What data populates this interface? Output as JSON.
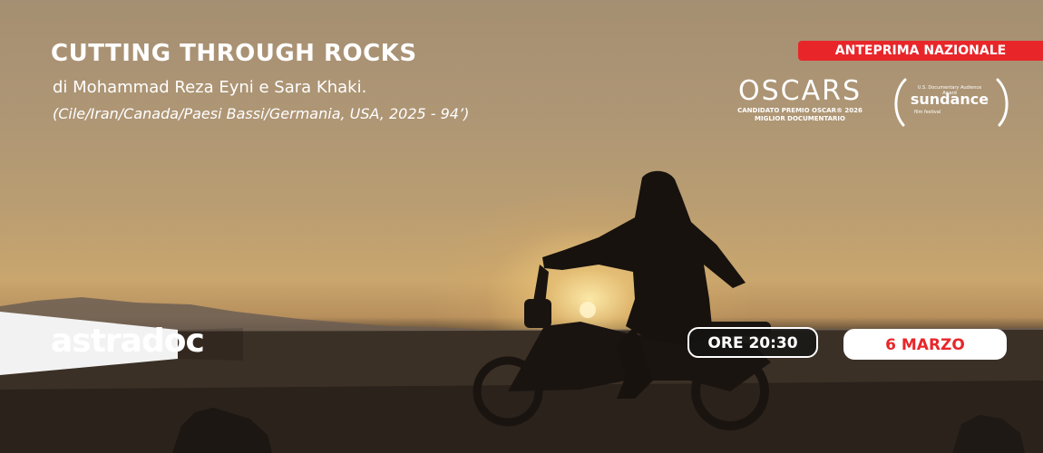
{
  "film": {
    "title": "CUTTING THROUGH ROCKS",
    "credits": "di Mohammad Reza Eyni e Sara Khaki.",
    "info": "(Cile/Iran/Canada/Paesi Bassi/Germania, USA, 2025 - 94’)"
  },
  "badge": {
    "label": "ANTEPRIMA NAZIONALE"
  },
  "oscars": {
    "word": "OSCARS",
    "line1": "CANDIDATO PREMIO OSCAR® 2026",
    "line2": "MIGLIOR DOCUMENTARIO"
  },
  "sundance": {
    "top": "U.S. Documentary Audience Award",
    "word": "sundance",
    "bottom": "film festival"
  },
  "logo": {
    "text": "astradoc"
  },
  "schedule": {
    "time": "ORE 20:30",
    "date": "6 MARZO"
  },
  "colors": {
    "accent": "#e8262a",
    "text": "#ffffff"
  }
}
